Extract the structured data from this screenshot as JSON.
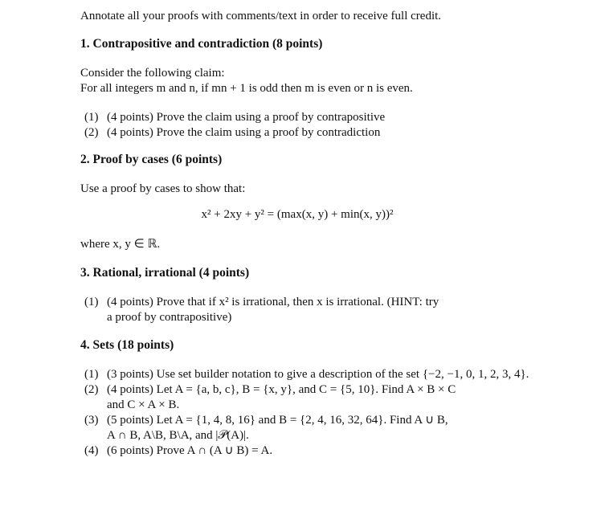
{
  "intro": "Annotate all your proofs with comments/text in order to receive full credit.",
  "sections": [
    {
      "title": "1. Contrapositive and contradiction (8 points)",
      "text": [
        "Consider the following claim:",
        "For all integers m and n, if mn + 1 is odd then m is even or n is even."
      ],
      "items": [
        {
          "num": "(1)",
          "text": "(4 points) Prove the claim using a proof by contrapositive"
        },
        {
          "num": "(2)",
          "text": "(4 points) Prove the claim using a proof by contradiction"
        }
      ]
    },
    {
      "title": "2. Proof by cases (6 points)",
      "text": [
        "Use a proof by cases to show that:"
      ],
      "equation": "x² + 2xy + y² = (max(x, y) + min(x, y))²",
      "after": "where x, y ∈ ℝ."
    },
    {
      "title": "3. Rational, irrational (4 points)",
      "items": [
        {
          "num": "(1)",
          "text": "(4 points) Prove that if x² is irrational, then x is irrational. (HINT: try",
          "cont": "a proof by contrapositive)"
        }
      ]
    },
    {
      "title": "4. Sets (18 points)",
      "items": [
        {
          "num": "(1)",
          "text": "(3 points) Use set builder notation to give a description of the set {−2, −1, 0, 1, 2, 3, 4}."
        },
        {
          "num": "(2)",
          "text": "(4 points) Let A = {a, b, c}, B = {x, y}, and C = {5, 10}. Find A × B × C",
          "cont": "and C × A × B."
        },
        {
          "num": "(3)",
          "text": "(5 points) Let A = {1, 4, 8, 16} and B = {2, 4, 16, 32, 64}. Find A ∪ B,",
          "cont": "A ∩ B, A\\B, B\\A, and |𝒫(A)|."
        },
        {
          "num": "(4)",
          "text": "(6 points) Prove A ∩ (A ∪ B) = A."
        }
      ]
    }
  ]
}
